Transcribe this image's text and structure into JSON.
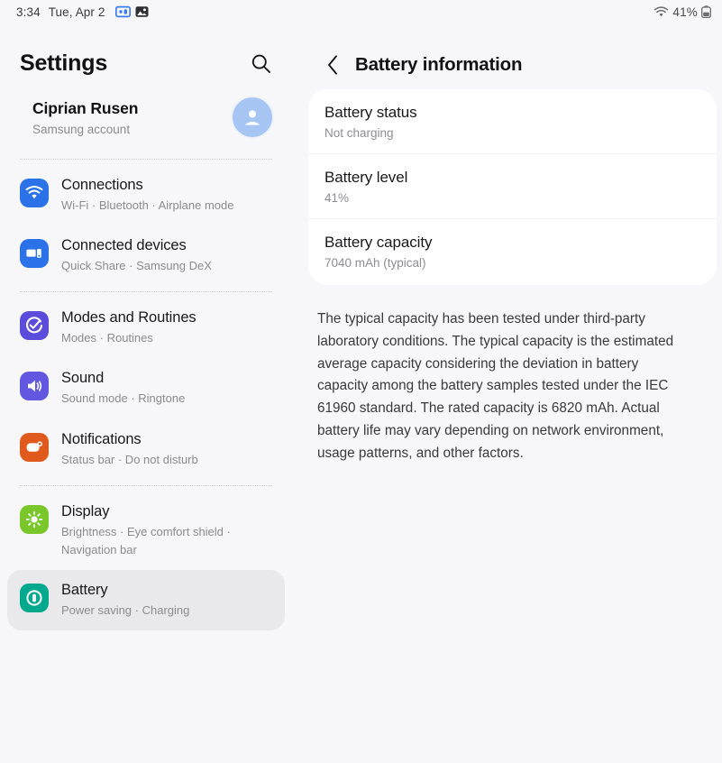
{
  "status_bar": {
    "time": "3:34",
    "date": "Tue, Apr 2",
    "left_icons": [
      "dex-device-icon",
      "gallery-image-icon"
    ],
    "wifi_icon": "wifi-icon",
    "battery_percent": "41%",
    "battery_icon": "battery-icon"
  },
  "sidebar": {
    "title": "Settings",
    "search_icon": "search-icon",
    "account": {
      "name": "Ciprian Rusen",
      "subtitle": "Samsung account",
      "avatar_icon": "person-avatar-icon",
      "avatar_color": "#a6c5f2"
    },
    "items": [
      {
        "label": "Connections",
        "sub": "Wi-Fi · Bluetooth · Airplane mode",
        "icon": "wifi-icon",
        "color": "#2b72e8",
        "selected": false
      },
      {
        "label": "Connected devices",
        "sub": "Quick Share · Samsung DeX",
        "icon": "connected-devices-icon",
        "color": "#2b72e8",
        "selected": false
      },
      {
        "label": "Modes and Routines",
        "sub": "Modes · Routines",
        "icon": "modes-routines-icon",
        "color": "#5b4cdb",
        "selected": false
      },
      {
        "label": "Sound",
        "sub": "Sound mode · Ringtone",
        "icon": "sound-speaker-icon",
        "color": "#6257e0",
        "selected": false
      },
      {
        "label": "Notifications",
        "sub": "Status bar · Do not disturb",
        "icon": "notifications-icon",
        "color": "#e05a1e",
        "selected": false
      },
      {
        "label": "Display",
        "sub": "Brightness · Eye comfort shield · Navigation bar",
        "icon": "display-brightness-icon",
        "color": "#7ac72b",
        "selected": false
      },
      {
        "label": "Battery",
        "sub": "Power saving · Charging",
        "icon": "battery-circle-icon",
        "color": "#00a88e",
        "selected": true
      }
    ]
  },
  "detail": {
    "back_icon": "chevron-left-icon",
    "title": "Battery information",
    "rows": [
      {
        "label": "Battery status",
        "value": "Not charging"
      },
      {
        "label": "Battery level",
        "value": "41%"
      },
      {
        "label": "Battery capacity",
        "value": "7040 mAh (typical)"
      }
    ],
    "note": "The typical capacity has been tested under third-party laboratory conditions. The typical capacity is the estimated average capacity considering the deviation in battery capacity among the battery samples tested under the IEC 61960 standard. The rated capacity is 6820 mAh. Actual battery life may vary depending on network environment, usage patterns, and other factors."
  }
}
